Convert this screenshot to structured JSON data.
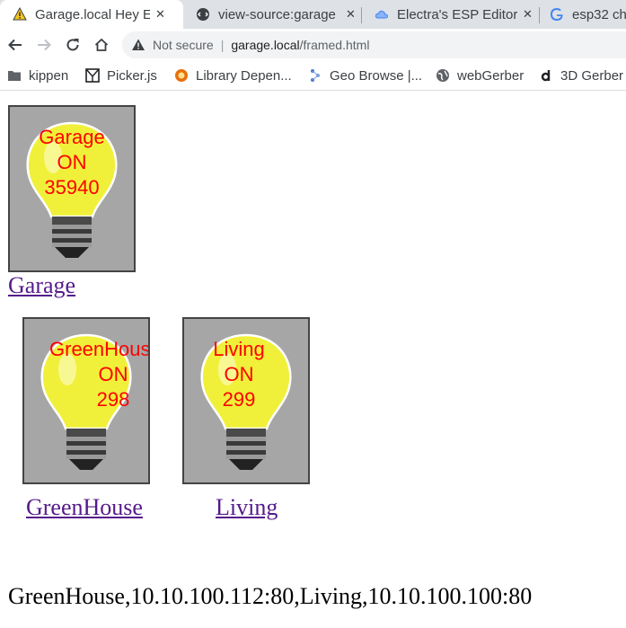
{
  "tabs": [
    {
      "title": "Garage.local Hey E",
      "icon": "warning-icon",
      "active": true
    },
    {
      "title": "view-source:garage",
      "icon": "source-icon",
      "active": false
    },
    {
      "title": "Electra's ESP Editor",
      "icon": "cloud-icon",
      "active": false
    },
    {
      "title": "esp32 ch",
      "icon": "google-icon",
      "active": false
    }
  ],
  "tab_close": "✕",
  "omnibox": {
    "security_text": "Not secure",
    "separator": "|",
    "host": "garage.local",
    "path": "/framed.html"
  },
  "bookmarks": [
    {
      "label": "kippen",
      "icon": "folder-icon"
    },
    {
      "label": "Picker.js",
      "icon": "picker-icon"
    },
    {
      "label": "Library Depen...",
      "icon": "library-icon"
    },
    {
      "label": "Geo Browse |...",
      "icon": "geo-icon"
    },
    {
      "label": "webGerber",
      "icon": "globe-icon"
    },
    {
      "label": "3D Gerber",
      "icon": "d-icon"
    }
  ],
  "devices": [
    {
      "name": "Garage",
      "state": "ON",
      "value": "35940",
      "link": "Garage"
    },
    {
      "name": "GreenHouse",
      "state": "ON",
      "value": "298",
      "link": "GreenHouse"
    },
    {
      "name": "Living",
      "state": "ON",
      "value": "299",
      "link": "Living"
    }
  ],
  "servers_line": "GreenHouse,10.10.100.112:80,Living,10.10.100.100:80",
  "colors": {
    "bulb_text": "#ff0000",
    "bulb_glass": "#f0f03a",
    "link": "#551a8b",
    "tile_bg": "#a6a6a6"
  }
}
